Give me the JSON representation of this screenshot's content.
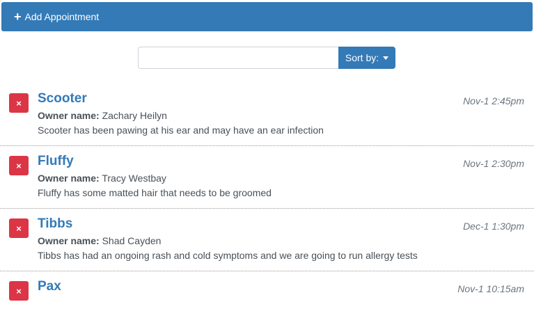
{
  "add_button": {
    "icon": "plus-icon",
    "label": "Add Appointment"
  },
  "search": {
    "value": "",
    "placeholder": ""
  },
  "sort_button": {
    "label": "Sort by:"
  },
  "owner_label": "Owner name:",
  "delete_glyph": "×",
  "colors": {
    "primary": "#337ab7",
    "danger": "#dc3545",
    "muted": "#6c757d"
  },
  "appointments": [
    {
      "pet_name": "Scooter",
      "date": "Nov-1 2:45pm",
      "owner": "Zachary Heilyn",
      "notes": "Scooter has been pawing at his ear and may have an ear infection"
    },
    {
      "pet_name": "Fluffy",
      "date": "Nov-1 2:30pm",
      "owner": "Tracy Westbay",
      "notes": "Fluffy has some matted hair that needs to be groomed"
    },
    {
      "pet_name": "Tibbs",
      "date": "Dec-1 1:30pm",
      "owner": "Shad Cayden",
      "notes": "Tibbs has had an ongoing rash and cold symptoms and we are going to run allergy tests"
    },
    {
      "pet_name": "Pax",
      "date": "Nov-1 10:15am",
      "owner": "",
      "notes": ""
    }
  ]
}
